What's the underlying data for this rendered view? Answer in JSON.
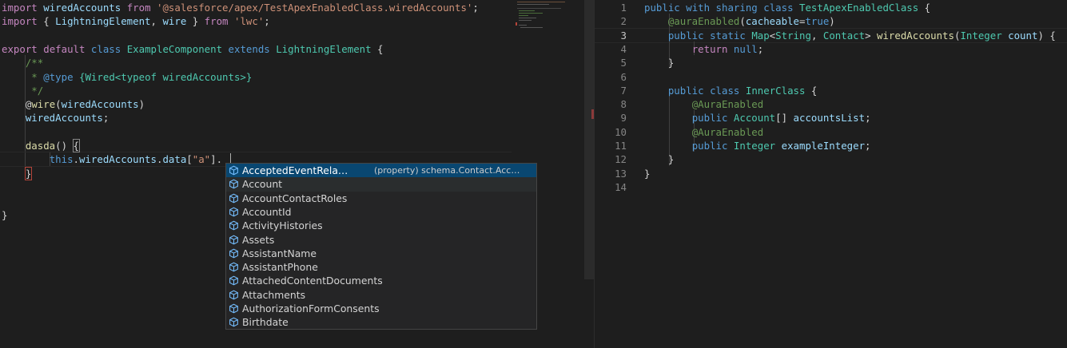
{
  "left_editor": {
    "lines": [
      [
        [
          "kw2",
          "import"
        ],
        [
          "plain",
          " "
        ],
        [
          "var",
          "wiredAccounts"
        ],
        [
          "plain",
          " "
        ],
        [
          "kw2",
          "from"
        ],
        [
          "plain",
          " "
        ],
        [
          "str",
          "'@salesforce/apex/TestApexEnabledClass.wiredAccounts'"
        ],
        [
          "plain",
          ";"
        ]
      ],
      [
        [
          "kw2",
          "import"
        ],
        [
          "plain",
          " { "
        ],
        [
          "var",
          "LightningElement"
        ],
        [
          "plain",
          ", "
        ],
        [
          "var",
          "wire"
        ],
        [
          "plain",
          " } "
        ],
        [
          "kw2",
          "from"
        ],
        [
          "plain",
          " "
        ],
        [
          "str",
          "'lwc'"
        ],
        [
          "plain",
          ";"
        ]
      ],
      [],
      [
        [
          "kw2",
          "export"
        ],
        [
          "plain",
          " "
        ],
        [
          "kw2",
          "default"
        ],
        [
          "plain",
          " "
        ],
        [
          "kw",
          "class"
        ],
        [
          "plain",
          " "
        ],
        [
          "typ",
          "ExampleComponent"
        ],
        [
          "plain",
          " "
        ],
        [
          "kw",
          "extends"
        ],
        [
          "plain",
          " "
        ],
        [
          "typ",
          "LightningElement"
        ],
        [
          "plain",
          " {"
        ]
      ],
      [
        [
          "plain",
          "    "
        ],
        [
          "cmt",
          "/**"
        ]
      ],
      [
        [
          "plain",
          "    "
        ],
        [
          "cmt",
          " * "
        ],
        [
          "kw",
          "@type"
        ],
        [
          "cmt",
          " "
        ],
        [
          "typ",
          "{Wired<typeof wiredAccounts>}"
        ]
      ],
      [
        [
          "plain",
          "    "
        ],
        [
          "cmt",
          " */"
        ]
      ],
      [
        [
          "plain",
          "    @"
        ],
        [
          "fn",
          "wire"
        ],
        [
          "plain",
          "("
        ],
        [
          "var",
          "wiredAccounts"
        ],
        [
          "plain",
          ")"
        ]
      ],
      [
        [
          "plain",
          "    "
        ],
        [
          "var",
          "wiredAccounts"
        ],
        [
          "plain",
          ";"
        ]
      ],
      [],
      [
        [
          "plain",
          "    "
        ],
        [
          "fn",
          "dasda"
        ],
        [
          "plain",
          "() "
        ],
        [
          "plain",
          "{"
        ]
      ],
      [
        [
          "plain",
          "        "
        ],
        [
          "kw",
          "this"
        ],
        [
          "plain",
          "."
        ],
        [
          "var",
          "wiredAccounts"
        ],
        [
          "plain",
          "."
        ],
        [
          "var",
          "data"
        ],
        [
          "plain",
          "["
        ],
        [
          "str",
          "\"a\""
        ],
        [
          "plain",
          "]."
        ]
      ],
      [
        [
          "plain",
          "    }"
        ]
      ],
      [],
      [],
      [
        [
          "plain",
          "}"
        ]
      ]
    ]
  },
  "right_editor": {
    "line_numbers": [
      "1",
      "2",
      "3",
      "4",
      "5",
      "6",
      "7",
      "8",
      "9",
      "10",
      "11",
      "12",
      "13",
      "14"
    ],
    "active_line": "3",
    "lines": [
      [
        [
          "kw",
          "public"
        ],
        [
          "plain",
          " "
        ],
        [
          "kw",
          "with"
        ],
        [
          "plain",
          " "
        ],
        [
          "kw",
          "sharing"
        ],
        [
          "plain",
          " "
        ],
        [
          "kw",
          "class"
        ],
        [
          "plain",
          " "
        ],
        [
          "typ",
          "TestApexEnabledClass"
        ],
        [
          "plain",
          " {"
        ]
      ],
      [
        [
          "plain",
          "    "
        ],
        [
          "ann",
          "@auraEnabled"
        ],
        [
          "plain",
          "("
        ],
        [
          "var",
          "cacheable"
        ],
        [
          "plain",
          "="
        ],
        [
          "kw",
          "true"
        ],
        [
          "plain",
          ")"
        ]
      ],
      [
        [
          "plain",
          "    "
        ],
        [
          "kw",
          "public"
        ],
        [
          "plain",
          " "
        ],
        [
          "kw",
          "static"
        ],
        [
          "plain",
          " "
        ],
        [
          "typ",
          "Map"
        ],
        [
          "plain",
          "<"
        ],
        [
          "typ",
          "String"
        ],
        [
          "plain",
          ", "
        ],
        [
          "typ",
          "Contact"
        ],
        [
          "plain",
          "> "
        ],
        [
          "fn",
          "wiredAccounts"
        ],
        [
          "plain",
          "("
        ],
        [
          "typ",
          "Integer"
        ],
        [
          "plain",
          " "
        ],
        [
          "var",
          "count"
        ],
        [
          "plain",
          ") {"
        ]
      ],
      [
        [
          "plain",
          "        "
        ],
        [
          "kw2",
          "return"
        ],
        [
          "plain",
          " "
        ],
        [
          "kw",
          "null"
        ],
        [
          "plain",
          ";"
        ]
      ],
      [
        [
          "plain",
          "    }"
        ]
      ],
      [],
      [
        [
          "plain",
          "    "
        ],
        [
          "kw",
          "public"
        ],
        [
          "plain",
          " "
        ],
        [
          "kw",
          "class"
        ],
        [
          "plain",
          " "
        ],
        [
          "typ",
          "InnerClass"
        ],
        [
          "plain",
          " {"
        ]
      ],
      [
        [
          "plain",
          "        "
        ],
        [
          "ann",
          "@AuraEnabled"
        ]
      ],
      [
        [
          "plain",
          "        "
        ],
        [
          "kw",
          "public"
        ],
        [
          "plain",
          " "
        ],
        [
          "typ",
          "Account"
        ],
        [
          "plain",
          "[] "
        ],
        [
          "var",
          "accountsList"
        ],
        [
          "plain",
          ";"
        ]
      ],
      [
        [
          "plain",
          "        "
        ],
        [
          "ann",
          "@AuraEnabled"
        ]
      ],
      [
        [
          "plain",
          "        "
        ],
        [
          "kw",
          "public"
        ],
        [
          "plain",
          " "
        ],
        [
          "typ",
          "Integer"
        ],
        [
          "plain",
          " "
        ],
        [
          "var",
          "exampleInteger"
        ],
        [
          "plain",
          ";"
        ]
      ],
      [
        [
          "plain",
          "    }"
        ]
      ],
      [
        [
          "plain",
          "}"
        ]
      ],
      []
    ]
  },
  "suggest": {
    "items": [
      {
        "label": "AcceptedEventRela…",
        "detail": "(property) schema.Contact.Acc…"
      },
      {
        "label": "Account"
      },
      {
        "label": "AccountContactRoles"
      },
      {
        "label": "AccountId"
      },
      {
        "label": "ActivityHistories"
      },
      {
        "label": "Assets"
      },
      {
        "label": "AssistantName"
      },
      {
        "label": "AssistantPhone"
      },
      {
        "label": "AttachedContentDocuments"
      },
      {
        "label": "Attachments"
      },
      {
        "label": "AuthorizationFormConsents"
      },
      {
        "label": "Birthdate"
      }
    ],
    "selected_index": 0,
    "hover_index": 1,
    "item_icon": "property-cube-icon",
    "colors": {
      "selected_bg": "#094771",
      "icon": "#75beff"
    }
  }
}
